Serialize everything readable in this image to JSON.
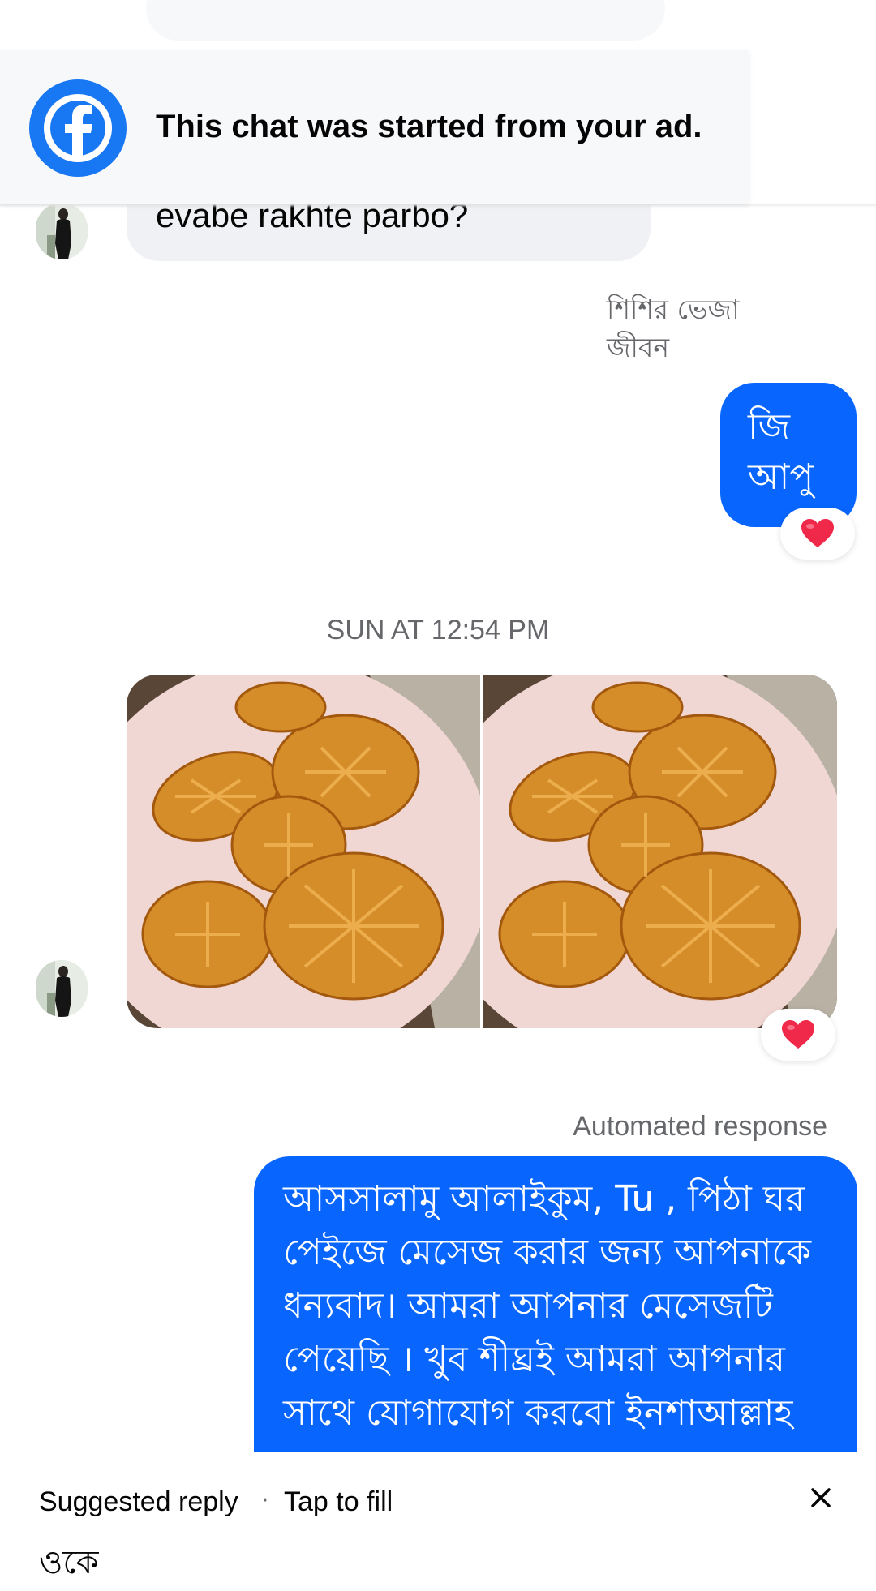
{
  "ad_banner": {
    "text": "This chat was started from your ad.",
    "icon": "facebook-logo-icon"
  },
  "thread": {
    "incoming_message_partial": "evabe rakhte parbo?",
    "sender_name": "শিশির ভেজা জীবন",
    "outgoing_message_1": "জি আপু",
    "reaction_1": "❤️",
    "timestamp": "SUN AT 12:54 PM",
    "photos": [
      "pitha-photo-1",
      "pitha-photo-2"
    ],
    "reaction_2": "❤️",
    "automated_label": "Automated response",
    "automated_message": "আসসালামু আলাইকুম, Tu , পিঠা ঘর পেইজে মেসেজ করার জন্য আপনাকে ধন্যবাদ। আমরা আপনার মেসেজটি পেয়েছি । খুব শীঘ্রই আমরা আপনার সাথে যোগাযোগ করবো ইনশাআল্লাহ"
  },
  "suggested_reply": {
    "label": "Suggested reply",
    "separator": "·",
    "hint": "Tap to fill",
    "text": "ওকে",
    "close_icon": "close-icon"
  },
  "colors": {
    "messenger_blue": "#0866ff",
    "facebook_blue": "#1877f2",
    "incoming_bubble": "#f0f1f4",
    "secondary_text": "#65676b"
  }
}
